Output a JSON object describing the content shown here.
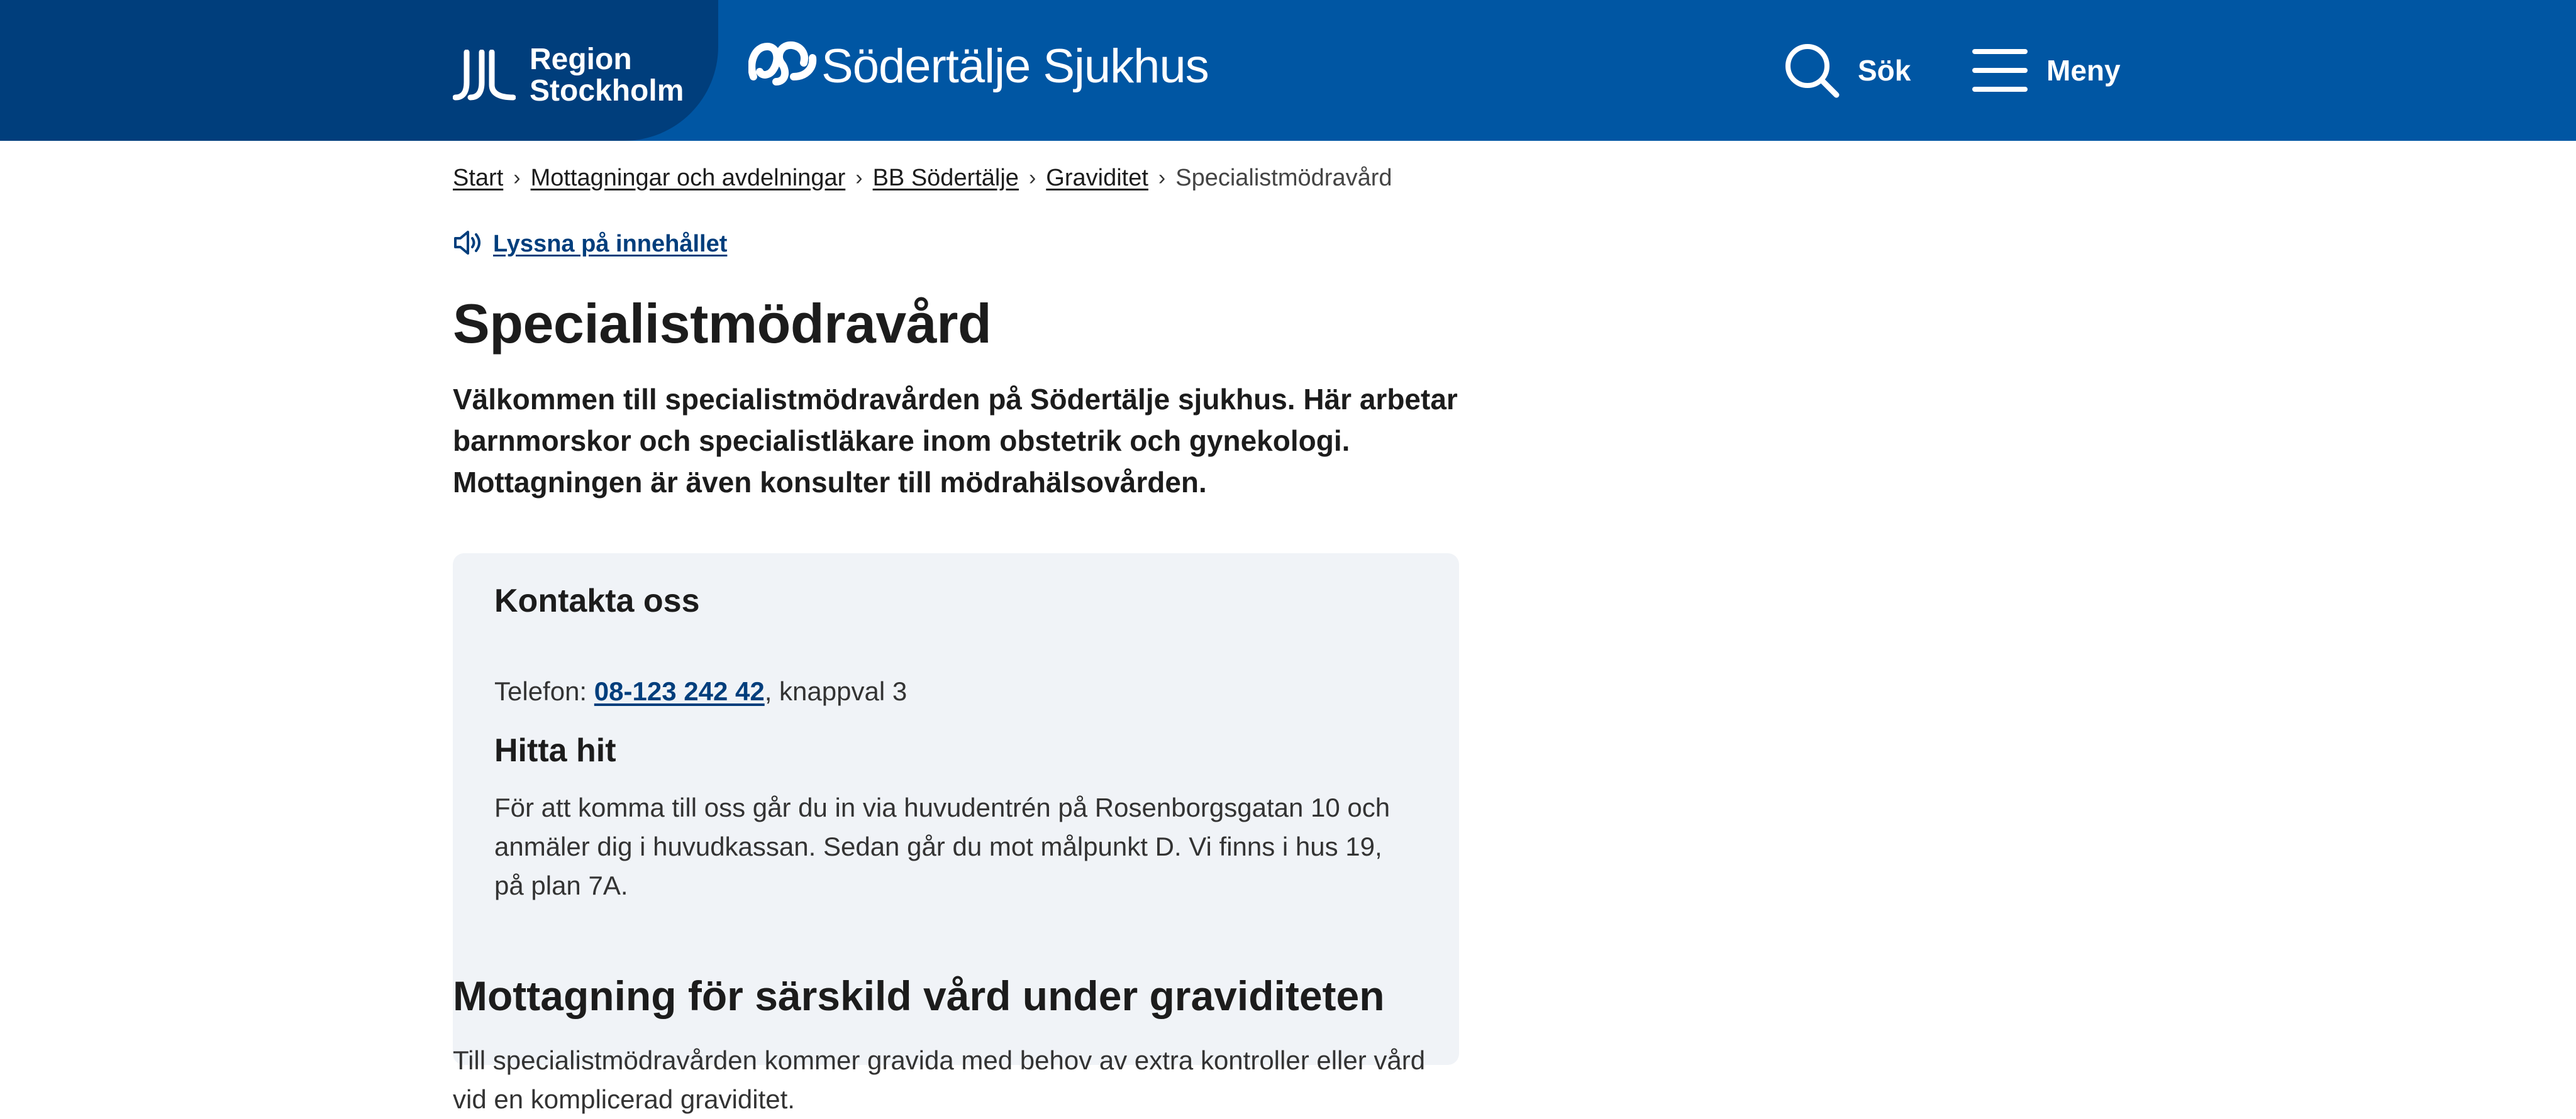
{
  "header": {
    "region_logo_line1": "Region",
    "region_logo_line2": "Stockholm",
    "hospital_name": "Södertälje Sjukhus",
    "search_label": "Sök",
    "menu_label": "Meny",
    "colors": {
      "bar": "#0056a3",
      "region_block": "#003e7c"
    },
    "icons": [
      "region-stockholm-logo-icon",
      "sodertalje-sjukhus-logo-icon",
      "search-icon",
      "hamburger-menu-icon"
    ]
  },
  "breadcrumb": {
    "items": [
      "Start",
      "Mottagningar och avdelningar",
      "BB Södertälje",
      "Graviditet"
    ],
    "current": "Specialistmödravård"
  },
  "listen": {
    "label": "Lyssna på innehållet",
    "icon": "speaker-icon"
  },
  "page": {
    "title": "Specialistmödravård",
    "intro": "Välkommen till specialistmödravården på Södertälje sjukhus. Här arbetar barnmorskor och specialistläkare inom obstetrik och gynekologi. Mottagningen är även konsulter till mödrahälsovården."
  },
  "contact": {
    "title": "Kontakta oss",
    "phone_prefix": "Telefon: ",
    "phone_number": "08-123 242 42",
    "phone_suffix": ", knappval 3",
    "directions_title": "Hitta hit",
    "directions_text": "För att komma till oss går du in via huvudentrén på Rosenborgsgatan 10 och anmäler dig i huvudkassan. Sedan går du mot målpunkt D. Vi finns i hus 19, på plan 7A."
  },
  "section": {
    "title": "Mottagning för särskild vård under graviditeten",
    "text": "Till specialistmödravården kommer gravida med behov av extra kontroller eller vård vid en komplicerad graviditet."
  }
}
